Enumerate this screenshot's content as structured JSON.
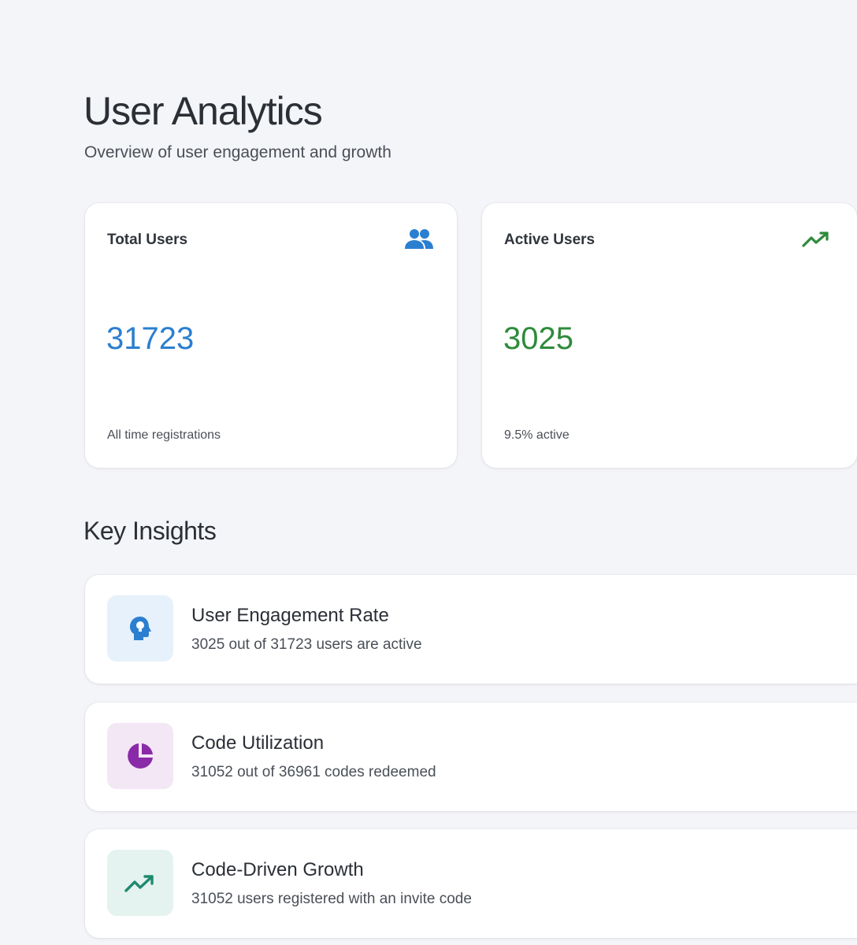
{
  "header": {
    "title": "User Analytics",
    "subtitle": "Overview of user engagement and growth"
  },
  "stats": [
    {
      "label": "Total Users",
      "value": "31723",
      "note": "All time registrations",
      "icon": "people-icon",
      "color": "#2b7fd0"
    },
    {
      "label": "Active Users",
      "value": "3025",
      "note": "9.5% active",
      "icon": "trending-up-icon",
      "color": "#2e8b3b"
    }
  ],
  "insights": {
    "title": "Key Insights",
    "items": [
      {
        "title": "User Engagement Rate",
        "description": "3025 out of 31723 users are active",
        "icon": "head-lightbulb-icon",
        "color": "#2b7fd0"
      },
      {
        "title": "Code Utilization",
        "description": "31052 out of 36961 codes redeemed",
        "icon": "pie-chart-icon",
        "color": "#8a2aa8"
      },
      {
        "title": "Code-Driven Growth",
        "description": "31052 users registered with an invite code",
        "icon": "trending-up-icon",
        "color": "#1f8a70"
      }
    ]
  }
}
